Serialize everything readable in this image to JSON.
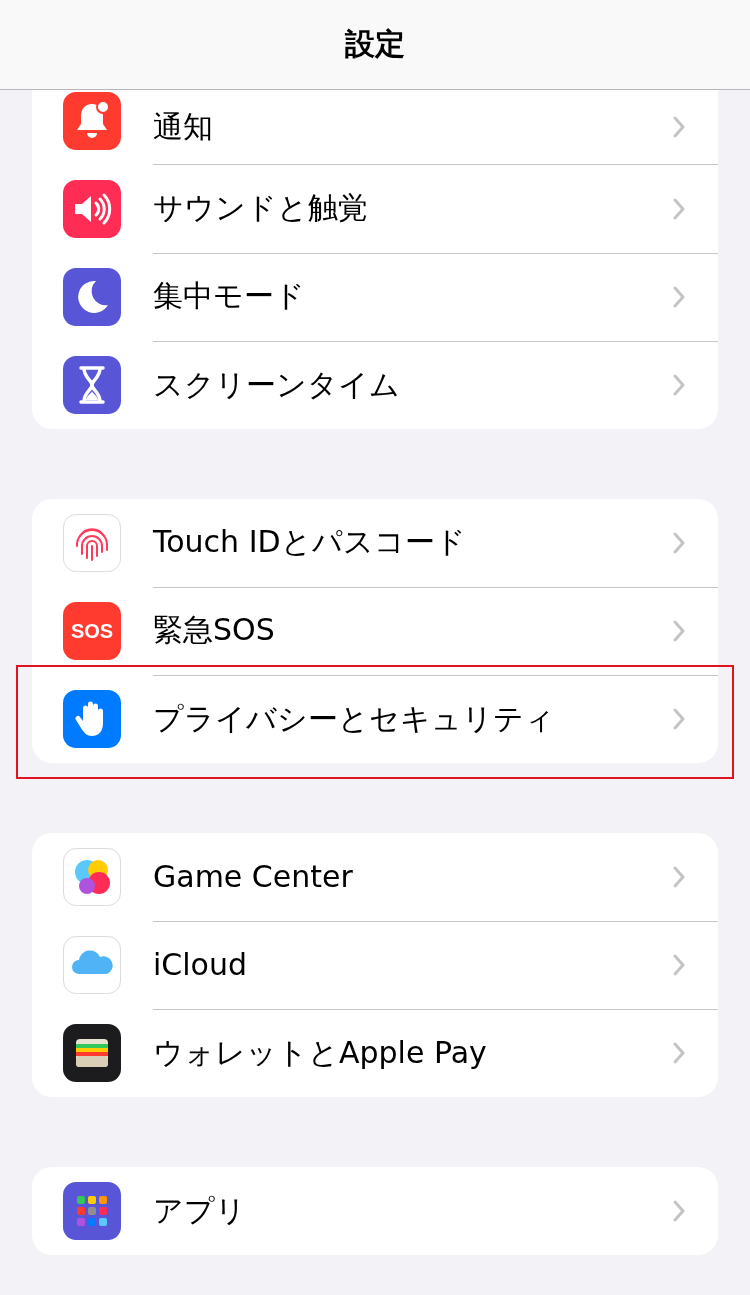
{
  "header": {
    "title": "設定"
  },
  "groups": [
    {
      "items": [
        {
          "label": "通知",
          "kind": "bell",
          "color": "#ff3b30",
          "highlighted": false
        },
        {
          "label": "サウンドと触覚",
          "kind": "speaker",
          "color": "#ff2d55",
          "highlighted": false
        },
        {
          "label": "集中モード",
          "kind": "moon",
          "color": "#5856d6",
          "highlighted": false
        },
        {
          "label": "スクリーンタイム",
          "kind": "hourglass",
          "color": "#5856d6",
          "highlighted": false
        }
      ]
    },
    {
      "items": [
        {
          "label": "Touch IDとパスコード",
          "kind": "fingerprint",
          "color": "#ffffff",
          "highlighted": false
        },
        {
          "label": "緊急SOS",
          "kind": "sos",
          "icon_text": "SOS",
          "color": "#ff3b30",
          "highlighted": false
        },
        {
          "label": "プライバシーとセキュリティ",
          "kind": "hand",
          "color": "#007aff",
          "highlighted": true
        }
      ]
    },
    {
      "items": [
        {
          "label": "Game Center",
          "kind": "gamecenter",
          "color": "#ffffff",
          "highlighted": false
        },
        {
          "label": "iCloud",
          "kind": "cloud",
          "color": "#ffffff",
          "highlighted": false
        },
        {
          "label": "ウォレットとApple Pay",
          "kind": "wallet",
          "color": "#1c1c1e",
          "highlighted": false
        }
      ]
    },
    {
      "items": [
        {
          "label": "アプリ",
          "kind": "apps",
          "color": "#5856d6",
          "highlighted": false
        }
      ]
    }
  ]
}
